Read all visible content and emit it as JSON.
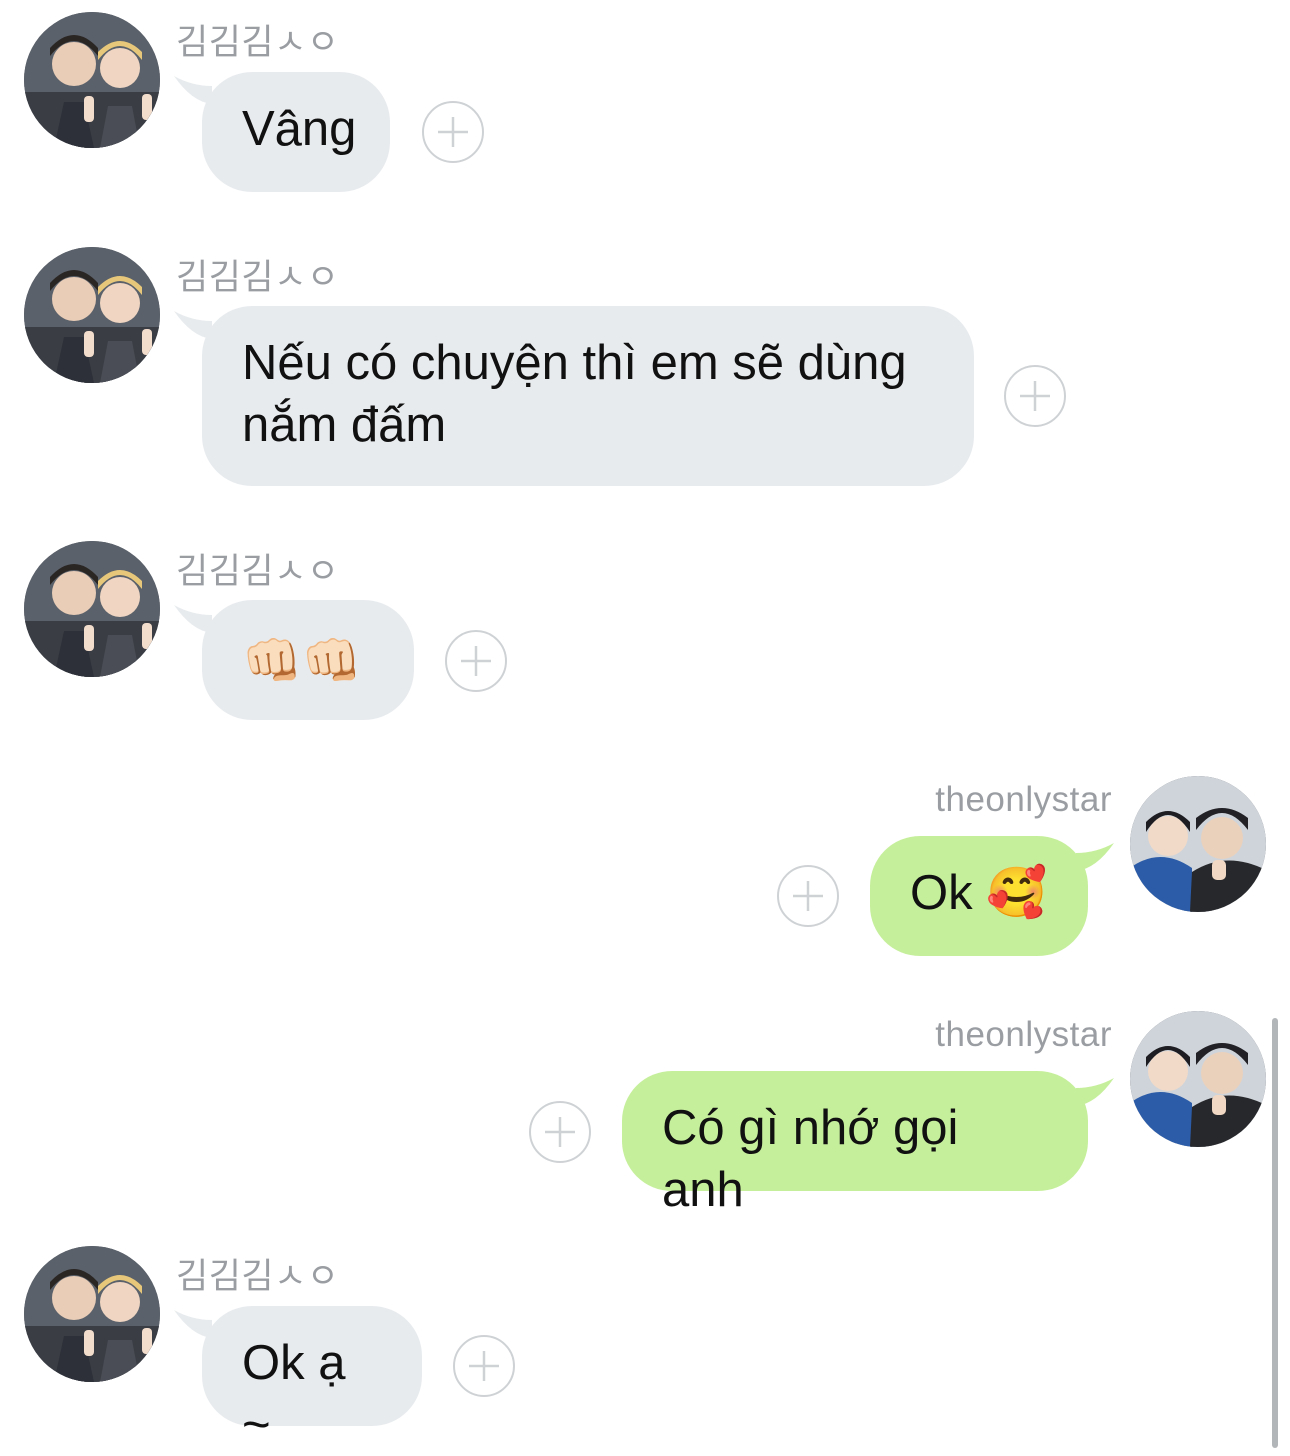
{
  "messages": [
    {
      "direction": "incoming",
      "sender": "김김김ㅅㅇ",
      "text": "Vâng",
      "avatar": "avatar-two-boys-peace-sign"
    },
    {
      "direction": "incoming",
      "sender": "김김김ㅅㅇ",
      "text": "Nếu có chuyện thì em sẽ dùng nắm đấm",
      "avatar": "avatar-two-boys-peace-sign"
    },
    {
      "direction": "incoming",
      "sender": "김김김ㅅㅇ",
      "text": "👊🏻👊🏻",
      "avatar": "avatar-two-boys-peace-sign"
    },
    {
      "direction": "outgoing",
      "sender": "theonlystar",
      "text": "Ok 🥰",
      "avatar": "avatar-two-guys-blue-black"
    },
    {
      "direction": "outgoing",
      "sender": "theonlystar",
      "text": "Có gì nhớ gọi anh",
      "avatar": "avatar-two-guys-blue-black"
    },
    {
      "direction": "incoming",
      "sender": "김김김ㅅㅇ",
      "text": "Ok ạ ~",
      "avatar": "avatar-two-boys-peace-sign"
    }
  ],
  "icons": {
    "add_reaction": "plus-circle-icon",
    "scrollbar": "vertical-scrollbar"
  },
  "colors": {
    "incoming_bubble": "#e8ebee",
    "outgoing_bubble": "#c6ef9c",
    "sender_text": "#9a9ea3",
    "plus_icon": "#cfd2d5"
  }
}
